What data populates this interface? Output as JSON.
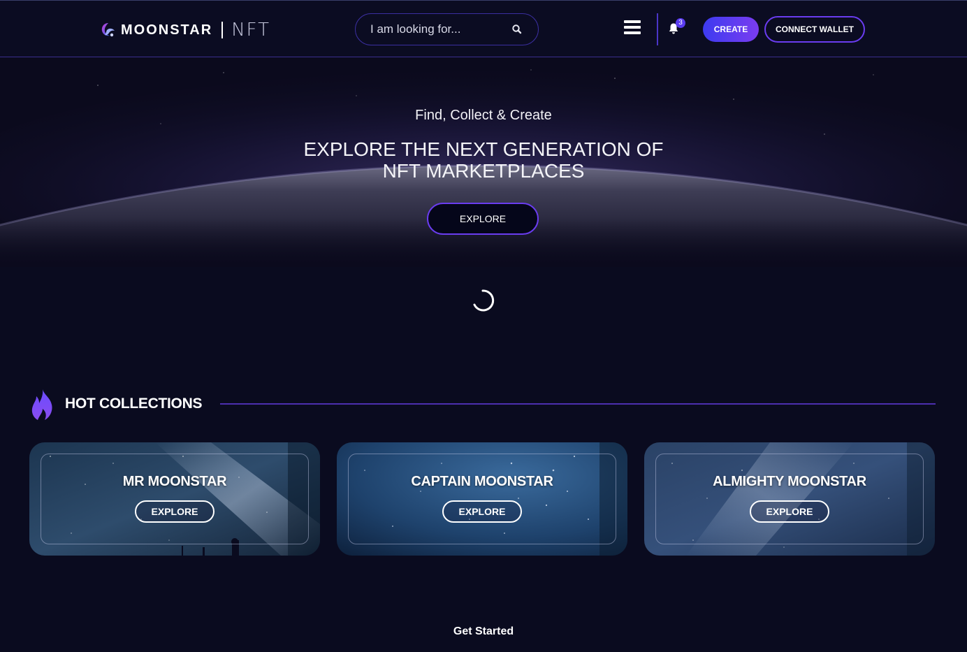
{
  "header": {
    "logo_text": "MOONSTAR",
    "logo_sub": "NFT",
    "search_placeholder": "I am looking for...",
    "notification_count": "3",
    "create_label": "CREATE",
    "connect_wallet_label": "CONNECT WALLET"
  },
  "hero": {
    "subtitle": "Find, Collect & Create",
    "title_line1": "EXPLORE THE NEXT GENERATION OF",
    "title_line2": "NFT MARKETPLACES",
    "explore_label": "EXPLORE"
  },
  "hot_collections": {
    "title": "HOT COLLECTIONS",
    "cards": [
      {
        "title": "MR MOONSTAR",
        "button": "EXPLORE"
      },
      {
        "title": "CAPTAIN MOONSTAR",
        "button": "EXPLORE"
      },
      {
        "title": "ALMIGHTY MOONSTAR",
        "button": "EXPLORE"
      }
    ]
  },
  "footer": {
    "get_started": "Get Started"
  },
  "colors": {
    "background": "#0a0b1f",
    "accent_purple": "#6a3cf0",
    "accent_blue": "#3d3bf0"
  },
  "icons": [
    "logo-mark-icon",
    "search-icon",
    "hamburger-menu-icon",
    "bell-icon",
    "loading-spinner-icon",
    "flame-icon"
  ]
}
